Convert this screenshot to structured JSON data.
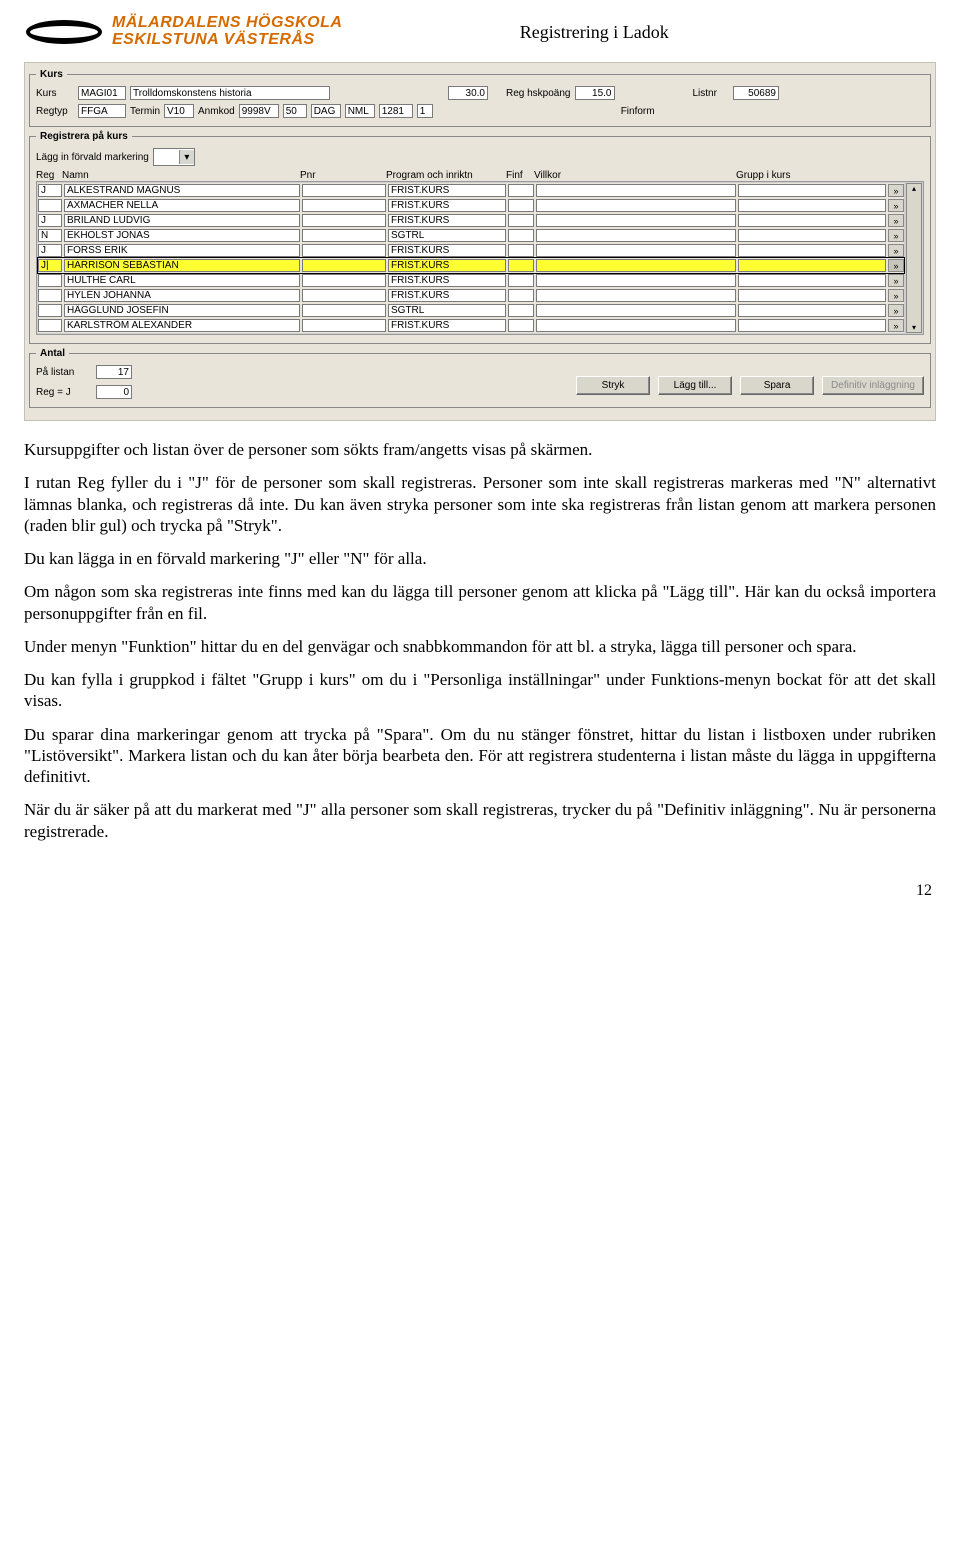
{
  "header": {
    "logo_line1": "MÄLARDALENS HÖGSKOLA",
    "logo_line2": "ESKILSTUNA VÄSTERÅS",
    "doc_title": "Registrering i Ladok"
  },
  "kurs_group": {
    "legend": "Kurs",
    "labels": {
      "kurs": "Kurs",
      "regtyp": "Regtyp",
      "termin": "Termin",
      "anmkod": "Anmkod",
      "reg_hskpoang": "Reg hskpoäng",
      "finform": "Finform",
      "listnr": "Listnr"
    },
    "values": {
      "kurs_code": "MAGI01",
      "kurs_name": "Trolldomskonstens historia",
      "points": "30.0",
      "reg_hsk": "15.0",
      "listnr": "50689",
      "regtyp": "FFGA",
      "termin": "V10",
      "anmkod": "9998V",
      "anm2": "50",
      "dag": "DAG",
      "nml": "NML",
      "num1": "1281",
      "num2": "1"
    }
  },
  "reg_group": {
    "legend": "Registrera på kurs",
    "combo_label": "Lägg in förvald markering",
    "columns": {
      "reg": "Reg",
      "namn": "Namn",
      "pnr": "Pnr",
      "prog": "Program och inriktn",
      "finf": "Finf",
      "villkor": "Villkor",
      "grupp": "Grupp i kurs"
    },
    "rows": [
      {
        "reg": "J",
        "namn": "ALKESTRAND MAGNUS",
        "prog": "FRIST.KURS",
        "hl": false
      },
      {
        "reg": "",
        "namn": "AXMACHER NELLA",
        "prog": "FRIST.KURS",
        "hl": false
      },
      {
        "reg": "J",
        "namn": "BRILAND LUDVIG",
        "prog": "FRIST.KURS",
        "hl": false
      },
      {
        "reg": "N",
        "namn": "EKHOLST JONAS",
        "prog": "SGTRL",
        "hl": false
      },
      {
        "reg": "J",
        "namn": "FORSS ERIK",
        "prog": "FRIST.KURS",
        "hl": false
      },
      {
        "reg": "J|",
        "namn": "HARRISON SEBASTIAN",
        "prog": "FRIST.KURS",
        "hl": true
      },
      {
        "reg": "",
        "namn": "HULTHE CARL",
        "prog": "FRIST.KURS",
        "hl": false
      },
      {
        "reg": "",
        "namn": "HYLÉN JOHANNA",
        "prog": "FRIST.KURS",
        "hl": false
      },
      {
        "reg": "",
        "namn": "HÄGGLUND JOSEFIN",
        "prog": "SGTRL",
        "hl": false
      },
      {
        "reg": "",
        "namn": "KARLSTRÖM ALEXANDER",
        "prog": "FRIST.KURS",
        "hl": false
      }
    ],
    "row_button_glyph": "»"
  },
  "antal_group": {
    "legend": "Antal",
    "labels": {
      "pa_listan": "På listan",
      "reg_j": "Reg = J"
    },
    "values": {
      "pa_listan": "17",
      "reg_j": "0"
    },
    "buttons": {
      "stryk": "Stryk",
      "lagg_till": "Lägg till...",
      "spara": "Spara",
      "definitiv": "Definitiv inläggning"
    }
  },
  "body": {
    "p1": "Kursuppgifter och listan över de personer som sökts fram/angetts visas på skärmen.",
    "p2": "I rutan Reg fyller du i \"J\" för de personer som skall registreras. Personer som inte skall registreras markeras med \"N\" alternativt lämnas blanka, och registreras då inte. Du kan även stryka personer som inte ska registreras från listan genom att markera personen (raden blir gul) och trycka på \"Stryk\".",
    "p3": "Du kan lägga in en förvald markering \"J\" eller \"N\" för alla.",
    "p4": "Om någon som ska registreras inte finns med kan du lägga till personer genom att klicka på \"Lägg till\". Här kan du också importera personuppgifter från en fil.",
    "p5": "Under menyn \"Funktion\" hittar du en del genvägar och snabbkommandon för att bl. a stryka, lägga till personer och spara.",
    "p6": "Du kan fylla i gruppkod i fältet \"Grupp i kurs\" om du i \"Personliga inställningar\" under Funktions-menyn bockat för att det skall visas.",
    "p7": "Du sparar dina markeringar genom att trycka på \"Spara\". Om du nu stänger fönstret, hittar du listan i listboxen under rubriken \"Listöversikt\". Markera listan och du kan åter börja bearbeta den. För att registrera studenterna i listan måste du lägga in uppgifterna definitivt.",
    "p8": "När du är säker på att du markerat med \"J\" alla personer som skall registreras, trycker du på \"Definitiv inläggning\". Nu är personerna registrerade."
  },
  "page_number": "12"
}
